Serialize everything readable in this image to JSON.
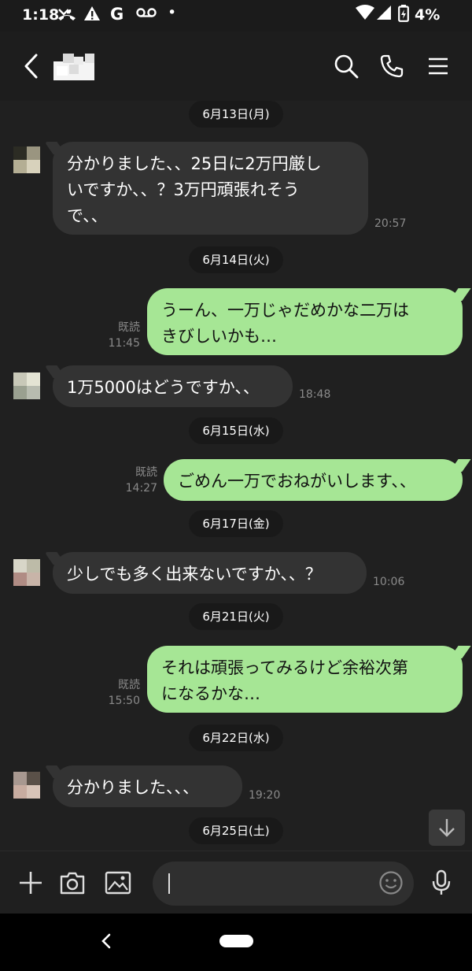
{
  "status_bar": {
    "time": "1:18",
    "battery": "4%"
  },
  "header": {
    "icons": [
      "back-icon",
      "search-icon",
      "phone-icon",
      "menu-icon"
    ]
  },
  "messages": [
    {
      "type": "date",
      "text": "6月13日(月)"
    },
    {
      "type": "in",
      "text": "分かりました、、25日に2万円厳し\nいですか、、？3万円頑張れそう\nで、、",
      "time": "20:57"
    },
    {
      "type": "date",
      "text": "6月14日(火)"
    },
    {
      "type": "out",
      "text": "うーん、一万じゃだめかな二万は\nきびしいかも…",
      "read": "既読",
      "time": "11:45"
    },
    {
      "type": "in",
      "text": "1万5000はどうですか、、",
      "time": "18:48"
    },
    {
      "type": "date",
      "text": "6月15日(水)"
    },
    {
      "type": "out",
      "text": "ごめん一万でおねがいします、、",
      "read": "既読",
      "time": "14:27"
    },
    {
      "type": "date",
      "text": "6月17日(金)"
    },
    {
      "type": "in",
      "text": "少しでも多く出来ないですか、、？",
      "time": "10:06"
    },
    {
      "type": "date",
      "text": "6月21日(火)"
    },
    {
      "type": "out",
      "text": "それは頑張ってみるけど余裕次第\nになるかな…",
      "read": "既読",
      "time": "15:50"
    },
    {
      "type": "date",
      "text": "6月22日(水)"
    },
    {
      "type": "in",
      "text": "分かりました、、、",
      "time": "19:20"
    },
    {
      "type": "date",
      "text": "6月25日(土)"
    }
  ],
  "input": {
    "value": "",
    "placeholder": ""
  },
  "colors": {
    "background": "#202020",
    "incoming_bubble": "#333333",
    "outgoing_bubble": "#a6e695",
    "meta_text": "#8a8a8a"
  }
}
